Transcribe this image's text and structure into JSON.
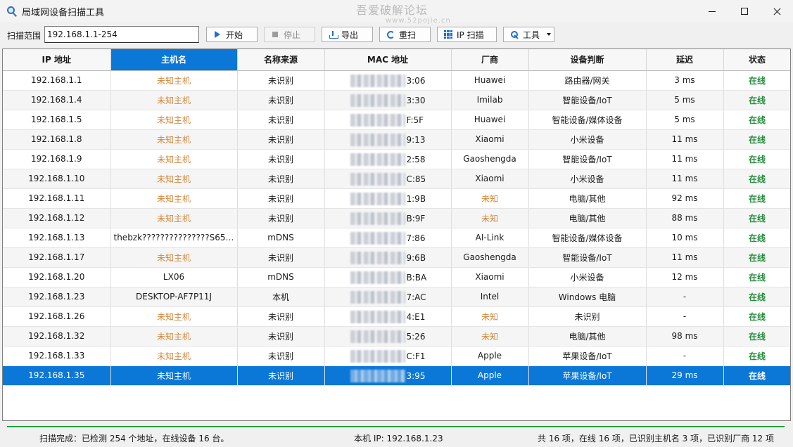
{
  "window": {
    "title": "局域网设备扫描工具",
    "watermark": "吾爱破解论坛",
    "watermark_sub": "www.52pojie.cn"
  },
  "toolbar": {
    "scan_label": "扫描范围",
    "scan_range": "192.168.1.1-254",
    "start_label": "开始",
    "stop_label": "停止",
    "export_label": "导出",
    "reset_label": "重扫",
    "ipscan_label": "IP 扫描",
    "tools_label": "工具"
  },
  "table": {
    "columns": [
      "IP 地址",
      "主机名",
      "名称来源",
      "MAC 地址",
      "厂商",
      "设备判断",
      "延迟",
      "状态"
    ],
    "sorted_column_index": 1,
    "selected_row_index": 15,
    "rows": [
      {
        "ip": "192.168.1.1",
        "host": "未知主机",
        "source": "未识别",
        "mac": "3:06",
        "vendor": "Huawei",
        "device": "路由器/网关",
        "latency": "3 ms",
        "status": "在线"
      },
      {
        "ip": "192.168.1.4",
        "host": "未知主机",
        "source": "未识别",
        "mac": "3:30",
        "vendor": "Imilab",
        "device": "智能设备/IoT",
        "latency": "5 ms",
        "status": "在线"
      },
      {
        "ip": "192.168.1.5",
        "host": "未知主机",
        "source": "未识别",
        "mac": "F:5F",
        "vendor": "Huawei",
        "device": "智能设备/媒体设备",
        "latency": "5 ms",
        "status": "在线"
      },
      {
        "ip": "192.168.1.8",
        "host": "未知主机",
        "source": "未识别",
        "mac": "9:13",
        "vendor": "Xiaomi",
        "device": "小米设备",
        "latency": "11 ms",
        "status": "在线"
      },
      {
        "ip": "192.168.1.9",
        "host": "未知主机",
        "source": "未识别",
        "mac": "2:58",
        "vendor": "Gaoshengda",
        "device": "智能设备/IoT",
        "latency": "11 ms",
        "status": "在线"
      },
      {
        "ip": "192.168.1.10",
        "host": "未知主机",
        "source": "未识别",
        "mac": "C:85",
        "vendor": "Xiaomi",
        "device": "小米设备",
        "latency": "11 ms",
        "status": "在线"
      },
      {
        "ip": "192.168.1.11",
        "host": "未知主机",
        "source": "未识别",
        "mac": "1:9B",
        "vendor": "未知",
        "device": "电脑/其他",
        "latency": "92 ms",
        "status": "在线"
      },
      {
        "ip": "192.168.1.12",
        "host": "未知主机",
        "source": "未识别",
        "mac": "B:9F",
        "vendor": "未知",
        "device": "电脑/其他",
        "latency": "88 ms",
        "status": "在线"
      },
      {
        "ip": "192.168.1.13",
        "host": "thebzk???????????????S65 ...",
        "source": "mDNS",
        "mac": "7:86",
        "vendor": "AI-Link",
        "device": "智能设备/媒体设备",
        "latency": "10 ms",
        "status": "在线"
      },
      {
        "ip": "192.168.1.17",
        "host": "未知主机",
        "source": "未识别",
        "mac": "9:6B",
        "vendor": "Gaoshengda",
        "device": "智能设备/IoT",
        "latency": "11 ms",
        "status": "在线"
      },
      {
        "ip": "192.168.1.20",
        "host": "LX06",
        "source": "mDNS",
        "mac": "B:BA",
        "vendor": "Xiaomi",
        "device": "小米设备",
        "latency": "12 ms",
        "status": "在线"
      },
      {
        "ip": "192.168.1.23",
        "host": "DESKTOP-AF7P11J",
        "source": "本机",
        "mac": "7:AC",
        "vendor": "Intel",
        "device": "Windows 电脑",
        "latency": "-",
        "status": "在线"
      },
      {
        "ip": "192.168.1.26",
        "host": "未知主机",
        "source": "未识别",
        "mac": "4:E1",
        "vendor": "未知",
        "device": "未识别",
        "latency": "-",
        "status": "在线"
      },
      {
        "ip": "192.168.1.32",
        "host": "未知主机",
        "source": "未识别",
        "mac": "5:26",
        "vendor": "未知",
        "device": "电脑/其他",
        "latency": "98 ms",
        "status": "在线"
      },
      {
        "ip": "192.168.1.33",
        "host": "未知主机",
        "source": "未识别",
        "mac": "C:F1",
        "vendor": "Apple",
        "device": "苹果设备/IoT",
        "latency": "-",
        "status": "在线"
      },
      {
        "ip": "192.168.1.35",
        "host": "未知主机",
        "source": "未识别",
        "mac": "3:95",
        "vendor": "Apple",
        "device": "苹果设备/IoT",
        "latency": "29 ms",
        "status": "在线"
      }
    ]
  },
  "statusbar": {
    "left": "扫描完成：已检测 254 个地址，在线设备 16 台。",
    "middle": "本机 IP: 192.168.1.23",
    "right": "共 16 项，在线 16 项，已识别主机名 3 项，已识别厂商 12 项",
    "progress": 1.0
  },
  "colors": {
    "accent": "#0b78d7",
    "unknown_text": "#d5873a",
    "online_text": "#238c3a",
    "progress": "#1fa23f"
  }
}
